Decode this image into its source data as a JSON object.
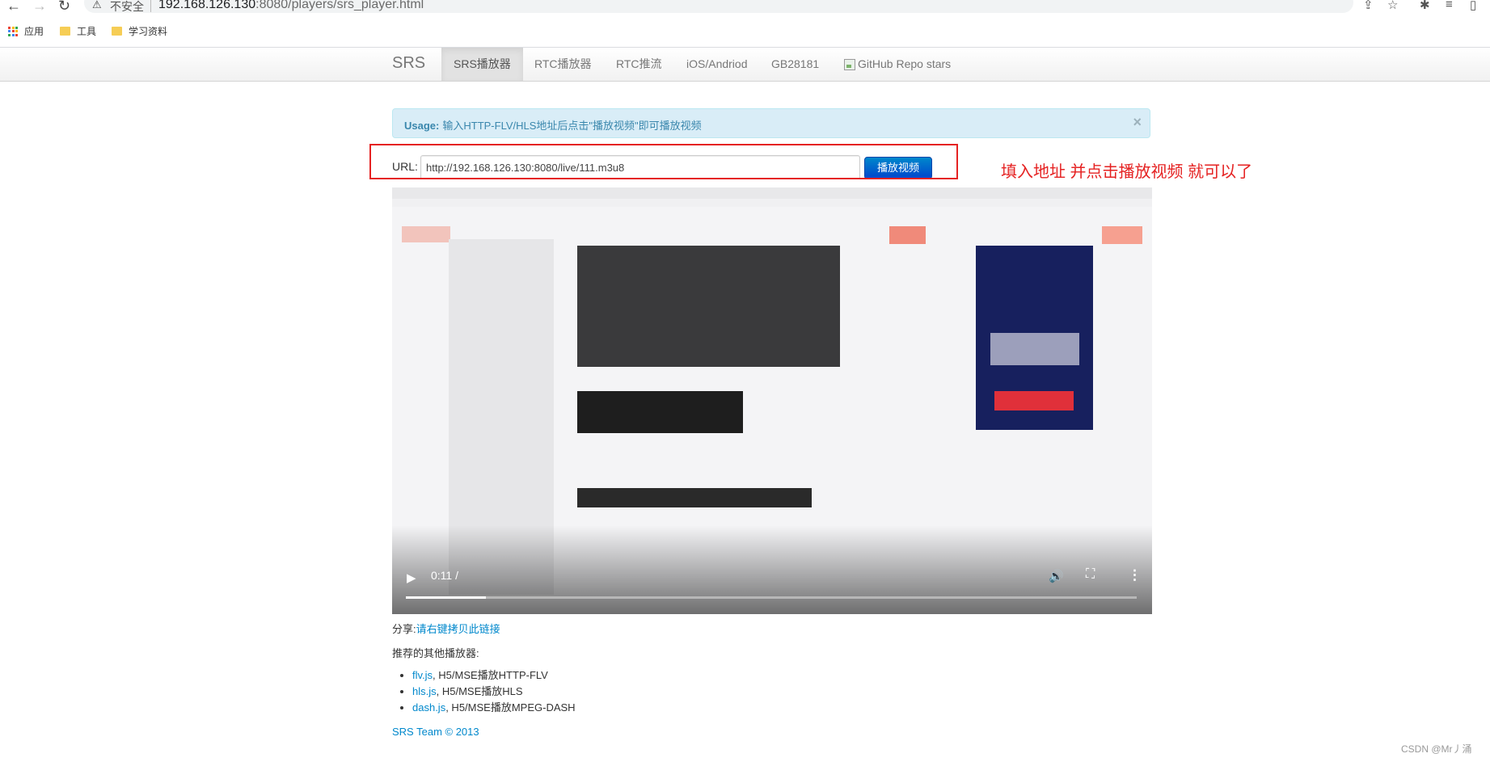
{
  "browser": {
    "not_secure": "不安全",
    "url_host": "192.168.126.130",
    "url_path": ":8080/players/srs_player.html",
    "bookmarks": [
      "应用",
      "工具",
      "学习资料"
    ]
  },
  "navbar": {
    "brand": "SRS",
    "items": [
      "SRS播放器",
      "RTC播放器",
      "RTC推流",
      "iOS/Andriod",
      "GB28181",
      "GitHub Repo stars"
    ],
    "active_index": 0
  },
  "alert": {
    "title": "Usage:",
    "text": "输入HTTP-FLV/HLS地址后点击\"播放视频\"即可播放视频",
    "close": "×"
  },
  "form": {
    "label": "URL:",
    "url_value": "http://192.168.126.130:8080/live/111.m3u8",
    "play_button": "播放视频"
  },
  "annotation": "填入地址  并点击播放视频 就可以了",
  "video": {
    "time": "0:11 /",
    "progress_fraction": 0.11
  },
  "share": {
    "label": "分享:",
    "link_text": "请右键拷贝此链接"
  },
  "recommend": {
    "title": "推荐的其他播放器:",
    "items": [
      {
        "name": "flv.js",
        "desc": ", H5/MSE播放HTTP-FLV"
      },
      {
        "name": "hls.js",
        "desc": ", H5/MSE播放HLS"
      },
      {
        "name": "dash.js",
        "desc": ", H5/MSE播放MPEG-DASH"
      }
    ]
  },
  "footer": "SRS Team © 2013",
  "watermark": "CSDN @Mr丿涌",
  "colors": {
    "accent": "#0088cc",
    "annotation_red": "#e52222",
    "alert_bg": "#d9edf7",
    "alert_text": "#3a87ad"
  }
}
